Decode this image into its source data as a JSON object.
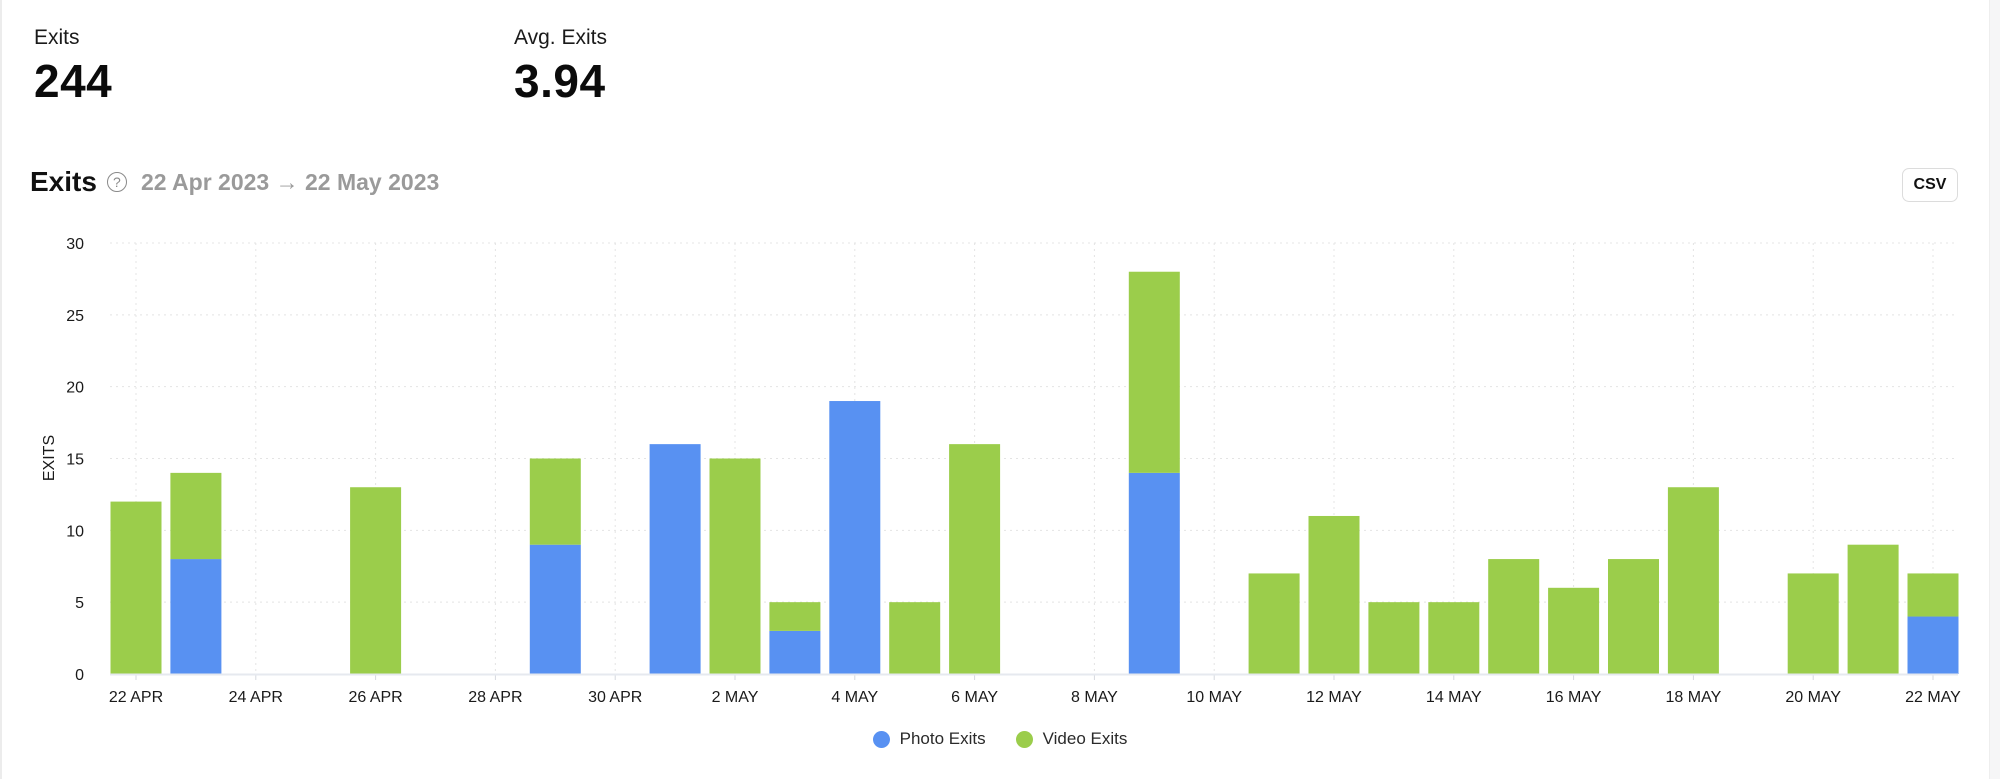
{
  "stats": [
    {
      "label": "Exits",
      "value": "244"
    },
    {
      "label": "Avg. Exits",
      "value": "3.94"
    }
  ],
  "header": {
    "title": "Exits",
    "help_icon": "question-circle-icon",
    "help_glyph": "?",
    "date_range": "22 Apr 2023 → 22 May 2023",
    "csv_label": "CSV"
  },
  "colors": {
    "photo": "#5891F2",
    "video": "#9BCD4B",
    "grid": "#e4e4e4",
    "baseline": "#e6e9ef"
  },
  "chart_data": {
    "type": "bar",
    "stacked": true,
    "title": "Exits",
    "xlabel": "",
    "ylabel": "EXITS",
    "ylim": [
      0,
      30
    ],
    "yticks": [
      0,
      5,
      10,
      15,
      20,
      25,
      30
    ],
    "grid": true,
    "legend_position": "bottom-center",
    "categories": [
      "22 Apr",
      "23 Apr",
      "24 Apr",
      "25 Apr",
      "26 Apr",
      "27 Apr",
      "28 Apr",
      "29 Apr",
      "30 Apr",
      "1 May",
      "2 May",
      "3 May",
      "4 May",
      "5 May",
      "6 May",
      "7 May",
      "8 May",
      "9 May",
      "10 May",
      "11 May",
      "12 May",
      "13 May",
      "14 May",
      "15 May",
      "16 May",
      "17 May",
      "18 May",
      "19 May",
      "20 May",
      "21 May",
      "22 May"
    ],
    "xtick_labels": [
      {
        "index": 0,
        "label": "22 APR"
      },
      {
        "index": 2,
        "label": "24 APR"
      },
      {
        "index": 4,
        "label": "26 APR"
      },
      {
        "index": 6,
        "label": "28 APR"
      },
      {
        "index": 8,
        "label": "30 APR"
      },
      {
        "index": 10,
        "label": "2 MAY"
      },
      {
        "index": 12,
        "label": "4 MAY"
      },
      {
        "index": 14,
        "label": "6 MAY"
      },
      {
        "index": 16,
        "label": "8 MAY"
      },
      {
        "index": 18,
        "label": "10 MAY"
      },
      {
        "index": 20,
        "label": "12 MAY"
      },
      {
        "index": 22,
        "label": "14 MAY"
      },
      {
        "index": 24,
        "label": "16 MAY"
      },
      {
        "index": 26,
        "label": "18 MAY"
      },
      {
        "index": 28,
        "label": "20 MAY"
      },
      {
        "index": 30,
        "label": "22 MAY"
      }
    ],
    "series": [
      {
        "name": "Photo Exits",
        "values": [
          0,
          8,
          0,
          0,
          0,
          0,
          0,
          9,
          0,
          16,
          0,
          3,
          19,
          0,
          0,
          0,
          0,
          14,
          0,
          0,
          0,
          0,
          0,
          0,
          0,
          0,
          0,
          0,
          0,
          0,
          4
        ]
      },
      {
        "name": "Video Exits",
        "values": [
          12,
          6,
          0,
          0,
          13,
          0,
          0,
          6,
          0,
          0,
          15,
          2,
          0,
          5,
          16,
          0,
          0,
          14,
          0,
          7,
          11,
          5,
          5,
          8,
          6,
          8,
          13,
          0,
          7,
          9,
          3
        ]
      }
    ]
  }
}
